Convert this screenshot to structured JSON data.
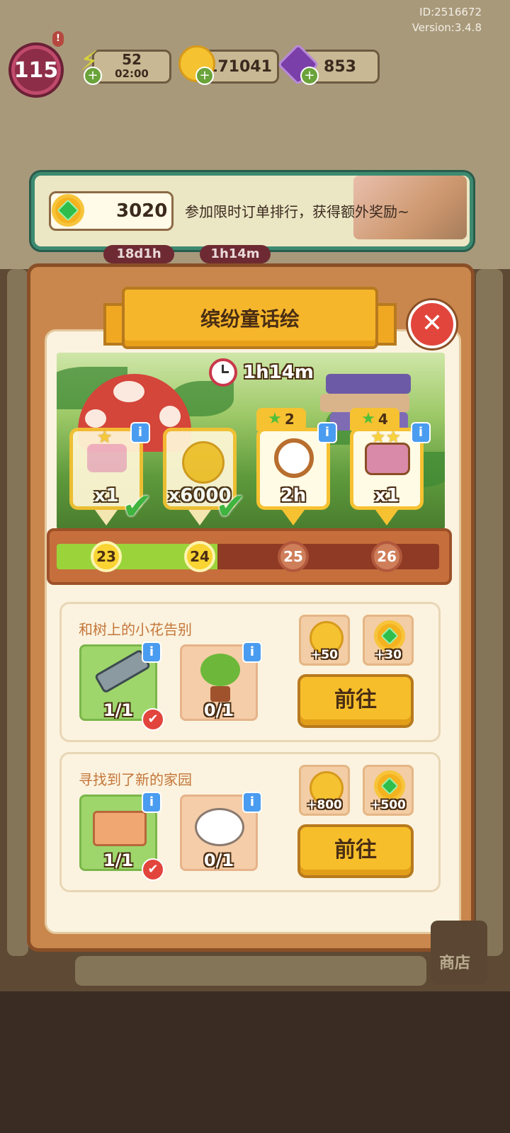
{
  "meta": {
    "id_text": "ID:2516672",
    "version_text": "Version:3.4.8"
  },
  "status": {
    "level": "115",
    "level_alert": "!",
    "energy": {
      "value": "52",
      "timer": "02:00",
      "icon": "lightning-icon"
    },
    "coins": {
      "value": "171041",
      "icon": "coin-icon"
    },
    "gems": {
      "value": "853",
      "icon": "purple-gem-icon"
    }
  },
  "banner": {
    "points": "3020",
    "text": "参加限时订单排行，获得额外奖励~",
    "icon": "flower-gem-icon"
  },
  "background_timers": [
    "18d1h",
    "1h14m"
  ],
  "modal": {
    "title": "缤纷童话绘",
    "close_icon": "close-icon",
    "event_timer": "1h14m",
    "rewards": [
      {
        "name": "pink-bed",
        "count": "x1",
        "stars": "",
        "claimed": true
      },
      {
        "name": "coin",
        "count": "x6000",
        "stars": "",
        "claimed": true
      },
      {
        "name": "stopwatch",
        "count": "2h",
        "stars": "2",
        "claimed": false
      },
      {
        "name": "pink-ornate-bed",
        "count": "x1",
        "stars": "4",
        "claimed": false
      }
    ],
    "progress": {
      "milestones": [
        "23",
        "24",
        "25",
        "26"
      ],
      "reached_index": 1,
      "fill_fraction": 0.42
    },
    "tasks": [
      {
        "title": "和树上的小花告别",
        "items": [
          {
            "name": "crutch-item",
            "count": "1/1",
            "done": true
          },
          {
            "name": "potted-tree-item",
            "count": "0/1",
            "done": false
          }
        ],
        "rewards": [
          {
            "type": "coin",
            "value": "+50"
          },
          {
            "type": "flower-gem",
            "value": "+30"
          }
        ],
        "button": "前往"
      },
      {
        "title": "寻找到了新的家园",
        "items": [
          {
            "name": "picnic-basket-item",
            "count": "1/1",
            "done": true
          },
          {
            "name": "sleeping-cat-item",
            "count": "0/1",
            "done": false
          }
        ],
        "rewards": [
          {
            "type": "coin",
            "value": "+800"
          },
          {
            "type": "flower-gem",
            "value": "+500"
          }
        ],
        "button": "前往"
      }
    ]
  },
  "bottom": {
    "shop_label": "商店"
  },
  "colors": {
    "modal_brown": "#c9874d",
    "ribbon_yellow": "#f6b62b",
    "progress_green": "#9bd43a",
    "close_red": "#e2453c",
    "banner_green": "#3d8a70"
  }
}
